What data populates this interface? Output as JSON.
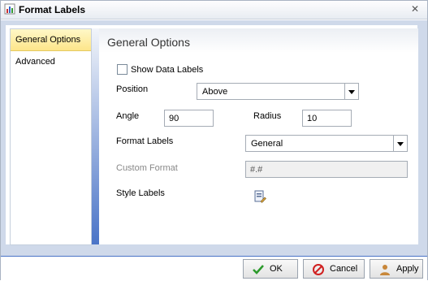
{
  "window": {
    "title": "Format Labels"
  },
  "nav": {
    "items": [
      {
        "label": "General Options"
      },
      {
        "label": "Advanced"
      }
    ]
  },
  "panel": {
    "title": "General Options",
    "show_data_labels": "Show Data Labels",
    "position_label": "Position",
    "position_value": "Above",
    "angle_label": "Angle",
    "angle_value": "90",
    "radius_label": "Radius",
    "radius_value": "10",
    "format_labels_label": "Format Labels",
    "format_labels_value": "General",
    "custom_format_label": "Custom Format",
    "custom_format_value": "#.#",
    "style_labels_label": "Style Labels"
  },
  "buttons": {
    "ok": "OK",
    "cancel": "Cancel",
    "apply": "Apply"
  },
  "colors": {
    "accent": "#4a74c7",
    "selected_nav": "#fde58a",
    "frame": "#cfd9ea"
  }
}
